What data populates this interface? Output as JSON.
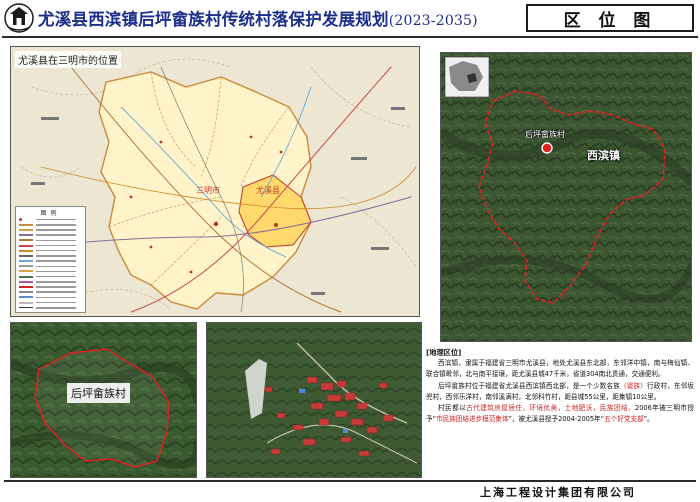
{
  "header": {
    "title": "尤溪县西滨镇后坪畲族村传统村落保护发展规划",
    "year_range": "(2023-2035)",
    "section_label": "区 位 图"
  },
  "main_map": {
    "caption": "尤溪县在三明市的位置",
    "city_label": "三明市",
    "county_label": "尤溪县",
    "legend_title": "图例"
  },
  "satellite": {
    "town_label": "西滨镇",
    "village_label": "后坪畲族村"
  },
  "detail_map": {
    "village_label": "后坪畲族村"
  },
  "text": {
    "heading": "[地理区位]",
    "para1": "西滨镇，隶属于福建省三明市尤溪县，地处尤溪县东北部，东邻洋中镇，南与梅仙镇、联合镇毗邻，北与南平接壤，距尤溪县城47千米，省道304南北贯通，交通便利。",
    "para2_a": "后坪畲族村位于福建省尤溪县西滨镇西北部，是一个少数名族",
    "para2_highlight": "（畲族）",
    "para2_b": "行政村，东邻坂兜村，西邻乐洋村，南邻溪满村，北邻科竹村，距县城55公里，距集镇10公里。",
    "para3_a": "村民都以",
    "para3_highlight": "古代建筑房屋居住，环境优美，土地肥沃，民族团结，",
    "para3_b": "2006年被三明市授予“",
    "para3_highlight2": "市民族团结进步模范集体",
    "para3_c": "”，被尤溪县授予2004-2005年“",
    "para3_highlight3": "五个好党支部",
    "para3_d": "”。"
  },
  "footer": {
    "company": "上海工程设计集团有限公司"
  },
  "colors": {
    "title_blue": "#1b2f8a",
    "boundary_red": "#d32020",
    "map_paper": "#f4efe0"
  }
}
